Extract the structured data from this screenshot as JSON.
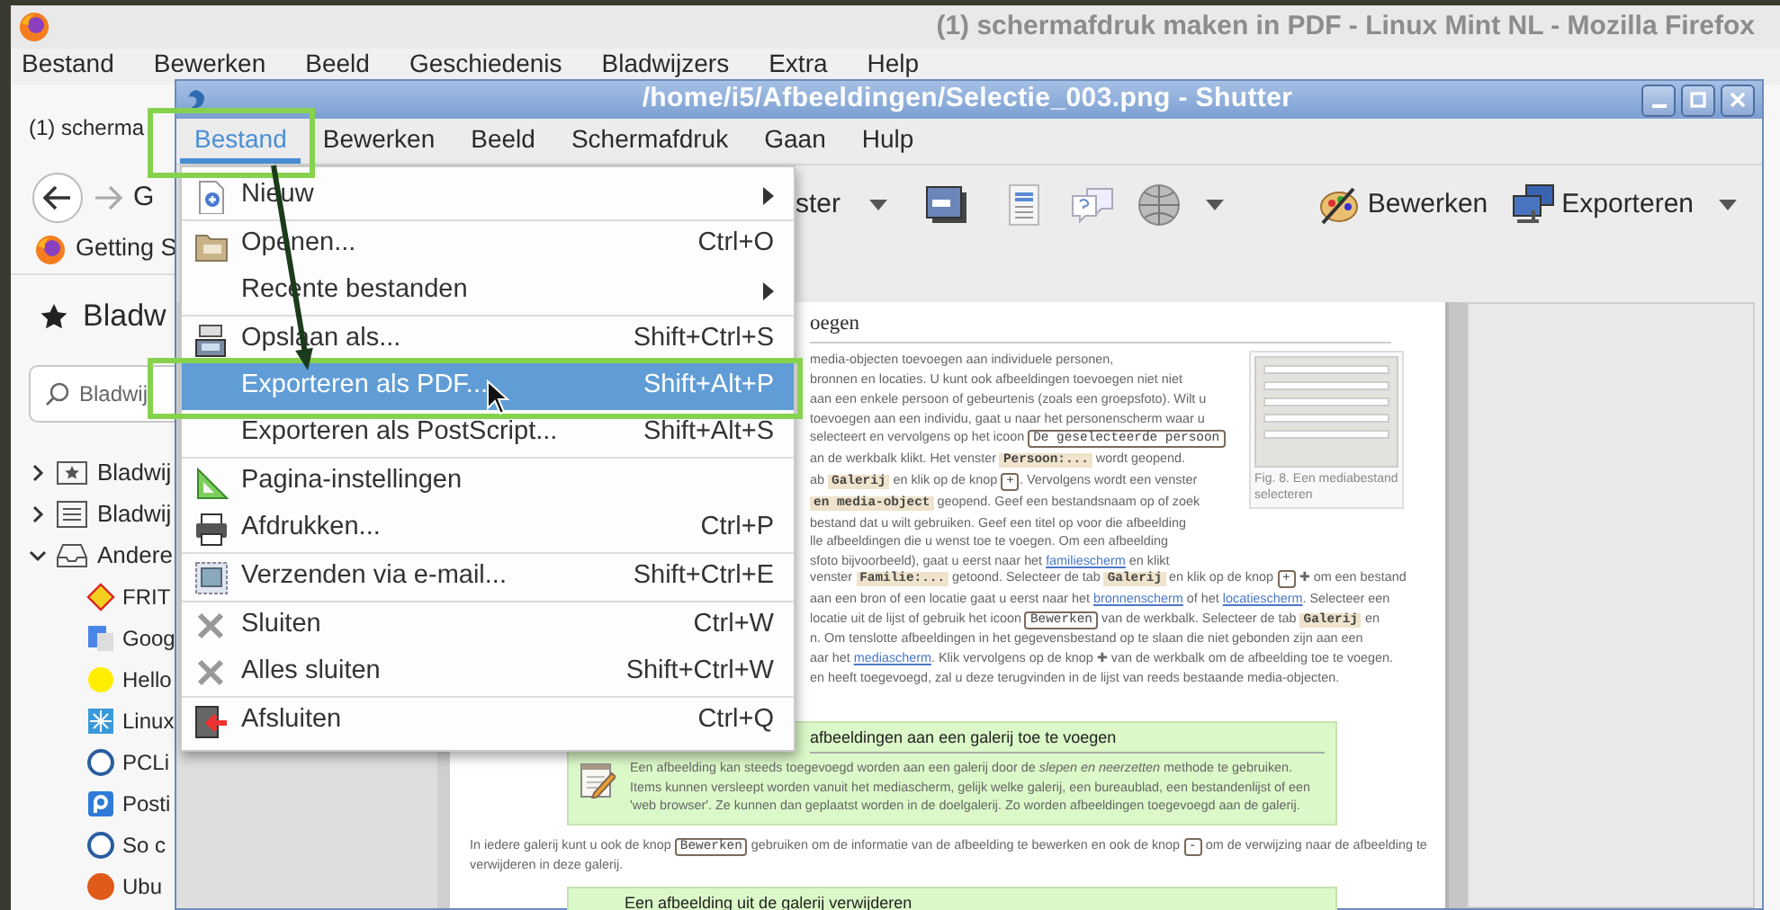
{
  "firefox": {
    "title": "(1) schermafdruk maken in PDF - Linux Mint NL - Mozilla Firefox",
    "menu": [
      "Bestand",
      "Bewerken",
      "Beeld",
      "Geschiedenis",
      "Bladwijzers",
      "Extra",
      "Help"
    ],
    "tab": "(1) scherma",
    "address_fragment": "G",
    "bookmark": "Getting S",
    "sidebar": {
      "heading": "Bladw",
      "search": {
        "placeholder": "Bladwij"
      },
      "tree": [
        {
          "label": "Bladwij",
          "expanded": false
        },
        {
          "label": "Bladwij",
          "expanded": false
        },
        {
          "label": "Andere",
          "expanded": true,
          "children": [
            {
              "label": "FRIT"
            },
            {
              "label": "Goog"
            },
            {
              "label": "Hello"
            },
            {
              "label": "Linux"
            },
            {
              "label": "PCLi"
            },
            {
              "label": "Posti"
            },
            {
              "label": "So c"
            },
            {
              "label": "Ubu"
            }
          ]
        }
      ]
    }
  },
  "shutter": {
    "title": "/home/i5/Afbeeldingen/Selectie_003.png - Shutter",
    "menu": [
      {
        "label": "Bestand",
        "selected": true
      },
      {
        "label": "Bewerken",
        "selected": false
      },
      {
        "label": "Beeld",
        "selected": false
      },
      {
        "label": "Schermafdruk",
        "selected": false
      },
      {
        "label": "Gaan",
        "selected": false
      },
      {
        "label": "Hulp",
        "selected": false
      }
    ],
    "toolbar": {
      "fragment": "ster",
      "buttons": [
        {
          "label": "Bewerken"
        },
        {
          "label": "Exporteren"
        }
      ]
    },
    "file_menu": [
      {
        "kind": "item",
        "label": "Nieuw",
        "submenu": true,
        "selected": false
      },
      {
        "kind": "separator"
      },
      {
        "kind": "item",
        "label": "Openen...",
        "shortcut": "Ctrl+O",
        "submenu": false,
        "selected": false
      },
      {
        "kind": "item",
        "label": "Recente bestanden",
        "submenu": true,
        "selected": false
      },
      {
        "kind": "separator"
      },
      {
        "kind": "item",
        "label": "Opslaan als...",
        "shortcut": "Shift+Ctrl+S",
        "submenu": false,
        "selected": false
      },
      {
        "kind": "item",
        "label": "Exporteren als PDF...",
        "shortcut": "Shift+Alt+P",
        "submenu": false,
        "selected": true
      },
      {
        "kind": "item",
        "label": "Exporteren als PostScript...",
        "shortcut": "Shift+Alt+S",
        "submenu": false,
        "selected": false
      },
      {
        "kind": "separator"
      },
      {
        "kind": "item",
        "label": "Pagina-instellingen",
        "submenu": false,
        "selected": false
      },
      {
        "kind": "item",
        "label": "Afdrukken...",
        "shortcut": "Ctrl+P",
        "submenu": false,
        "selected": false
      },
      {
        "kind": "separator"
      },
      {
        "kind": "item",
        "label": "Verzenden via e-mail...",
        "shortcut": "Shift+Ctrl+E",
        "submenu": false,
        "selected": false
      },
      {
        "kind": "separator"
      },
      {
        "kind": "item",
        "label": "Sluiten",
        "shortcut": "Ctrl+W",
        "submenu": false,
        "selected": false
      },
      {
        "kind": "item",
        "label": "Alles sluiten",
        "shortcut": "Shift+Ctrl+W",
        "submenu": false,
        "selected": false
      },
      {
        "kind": "separator"
      },
      {
        "kind": "item",
        "label": "Afsluiten",
        "shortcut": "Ctrl+Q",
        "submenu": false,
        "selected": false
      }
    ],
    "document": {
      "heading": "oegen",
      "lines": [
        [
          {
            "kind": "text",
            "text": "media-objecten toevoegen aan individuele personen,"
          }
        ],
        [
          {
            "kind": "text",
            "text": "bronnen en locaties. U kunt ook afbeeldingen toevoegen niet niet"
          }
        ],
        [
          {
            "kind": "text",
            "text": "aan een enkele persoon of gebeurtenis (zoals een groepsfoto). Wilt u"
          }
        ],
        [
          {
            "kind": "text",
            "text": "toevoegen aan een individu, gaat u naar het personenscherm waar u"
          }
        ],
        [
          {
            "kind": "text",
            "text": "selecteert en vervolgens op het icoon "
          },
          {
            "kind": "key",
            "text": "De geselecteerde persoon"
          }
        ],
        [
          {
            "kind": "text",
            "text": "an de werkbalk klikt. Het venster "
          },
          {
            "kind": "code",
            "text": "Persoon:..."
          },
          {
            "kind": "text",
            "text": " wordt geopend."
          }
        ],
        [
          {
            "kind": "text",
            "text": "ab "
          },
          {
            "kind": "code",
            "text": "Galerij"
          },
          {
            "kind": "text",
            "text": " en klik op de knop "
          },
          {
            "kind": "key",
            "text": "+"
          },
          {
            "kind": "text",
            "text": ". Vervolgens wordt een venster"
          }
        ],
        [
          {
            "kind": "code",
            "text": "en media-object"
          },
          {
            "kind": "text",
            "text": " geopend. Geef een bestandsnaam op of zoek"
          }
        ],
        [
          {
            "kind": "text",
            "text": "bestand dat u wilt gebruiken. Geef een titel op voor die afbeelding"
          }
        ],
        [
          {
            "kind": "text",
            "text": "lle afbeeldingen die u wenst toe te voegen. Om een afbeelding"
          }
        ],
        [
          {
            "kind": "text",
            "text": "sfoto bijvoorbeeld), gaat u eerst naar het "
          },
          {
            "kind": "link",
            "text": "familiescherm"
          },
          {
            "kind": "text",
            "text": " en klikt"
          }
        ],
        [
          {
            "kind": "text",
            "text": "venster "
          },
          {
            "kind": "code",
            "text": "Familie:..."
          },
          {
            "kind": "text",
            "text": " getoond. Selecteer de tab "
          },
          {
            "kind": "code",
            "text": "Galerij"
          },
          {
            "kind": "text",
            "text": " en klik op de knop "
          },
          {
            "kind": "key",
            "text": "+"
          },
          {
            "kind": "text",
            "text": " ✚ om een bestand"
          }
        ],
        [
          {
            "kind": "text",
            "text": "aan een bron of een locatie gaat u eerst naar het "
          },
          {
            "kind": "link",
            "text": "bronnenscherm"
          },
          {
            "kind": "text",
            "text": " of het "
          },
          {
            "kind": "link",
            "text": "locatiescherm"
          },
          {
            "kind": "text",
            "text": ". Selecteer een"
          }
        ],
        [
          {
            "kind": "text",
            "text": "locatie uit de lijst of gebruik het icoon "
          },
          {
            "kind": "key",
            "text": "Bewerken"
          },
          {
            "kind": "text",
            "text": " van de werkbalk. Selecteer de tab "
          },
          {
            "kind": "code",
            "text": "Galerij"
          },
          {
            "kind": "text",
            "text": " en"
          }
        ],
        [
          {
            "kind": "text",
            "text": "n. Om tenslotte afbeeldingen in het gegevensbestand op te slaan die niet gebonden zijn aan een"
          }
        ],
        [
          {
            "kind": "text",
            "text": "aar het "
          },
          {
            "kind": "link",
            "text": "mediascherm"
          },
          {
            "kind": "text",
            "text": ". Klik vervolgens op de knop ✚ van de werkbalk om de afbeelding toe te voegen."
          }
        ],
        [
          {
            "kind": "text",
            "text": "en heeft toegevoegd, zal u deze terugvinden in de lijst van reeds bestaande media-objecten."
          }
        ]
      ],
      "figure_caption": "Fig. 8. Een mediabestand selecteren",
      "note": {
        "heading": "afbeeldingen aan een galerij toe te voegen",
        "text": "Een afbeelding kan steeds toegevoegd worden aan een galerij door de *slepen en neerzetten* methode te gebruiken. Items kunnen versleept worden vanuit het mediascherm, gelijk welke galerij, een bureaublad, een bestandenlijst of een 'web browser'. Ze kunnen dan geplaatst worden in de doelgalerij. Zo worden afbeeldingen toegevoegd aan de galerij."
      },
      "paragraph": [
        {
          "kind": "text",
          "text": "In iedere galerij kunt u ook de knop "
        },
        {
          "kind": "key",
          "text": "Bewerken"
        },
        {
          "kind": "text",
          "text": " gebruiken om de informatie van de afbeelding te bewerken en ook de knop "
        },
        {
          "kind": "key",
          "text": "-"
        },
        {
          "kind": "text",
          "text": " om de verwijzing naar de afbeelding te verwijderen in deze galerij."
        }
      ],
      "note_2": {
        "heading": "Een afbeelding uit de galerij verwijderen"
      }
    }
  }
}
